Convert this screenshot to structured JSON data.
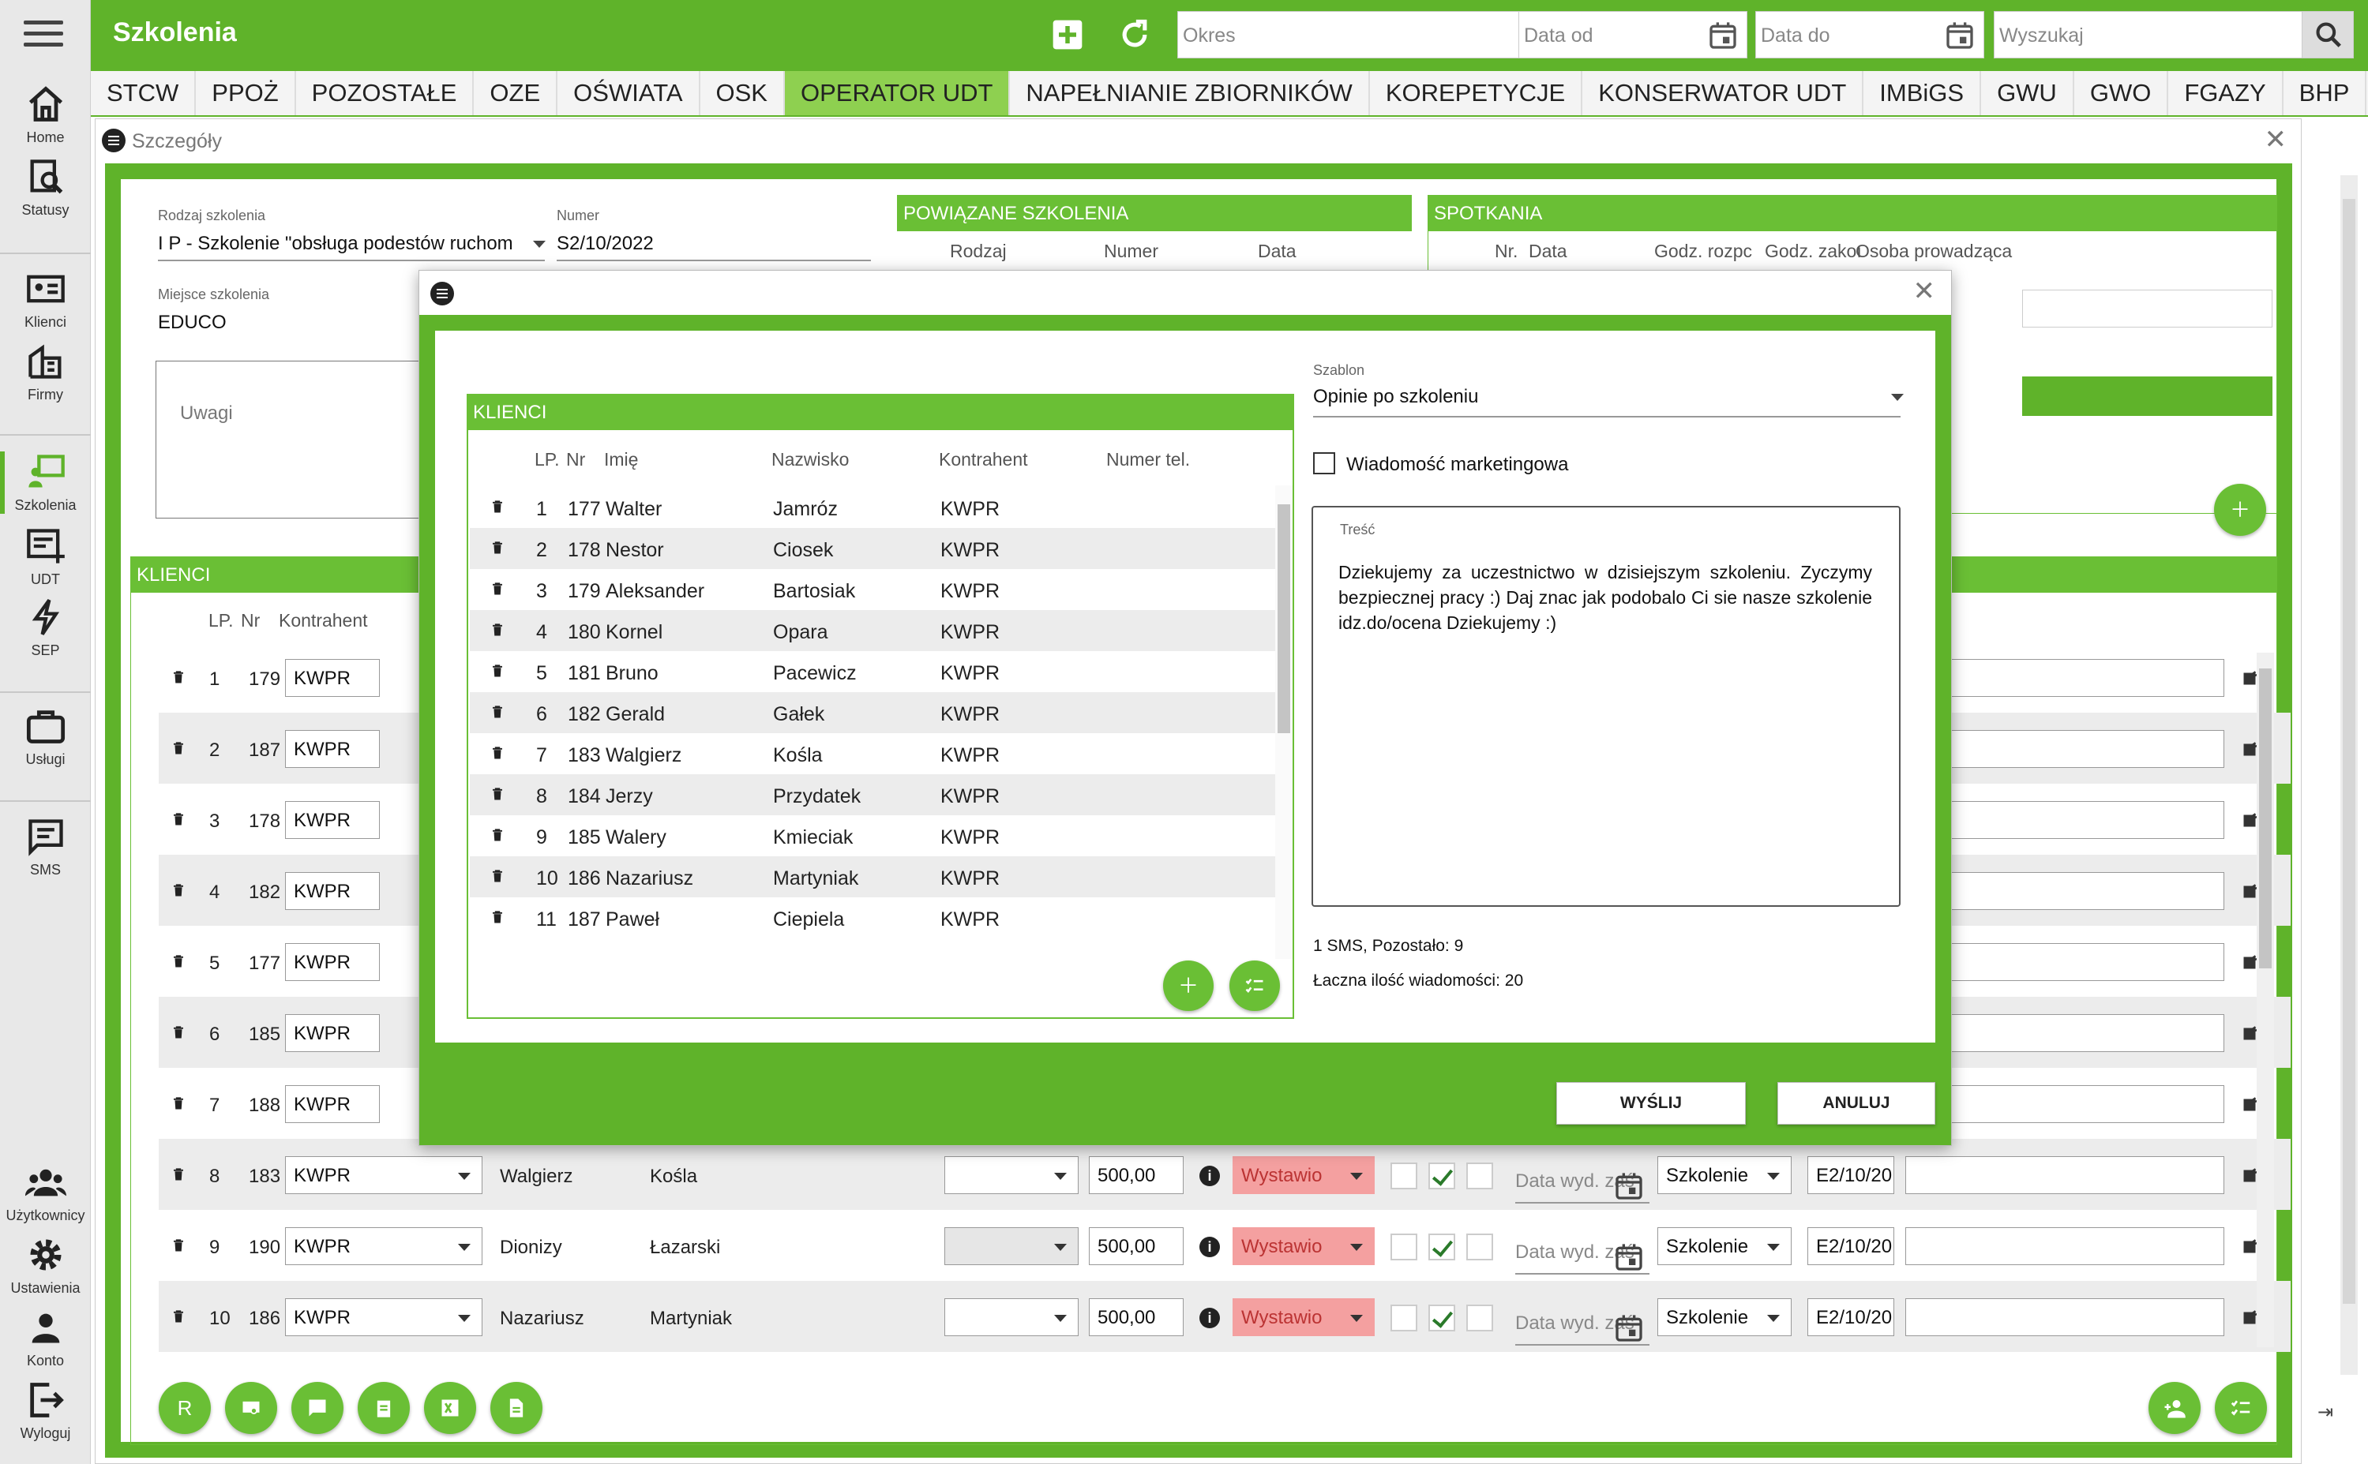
{
  "app": {
    "title": "Szkolenia"
  },
  "sidebar": {
    "items": [
      {
        "label": "Home",
        "icon": "home-icon"
      },
      {
        "label": "Statusy",
        "icon": "status-icon"
      },
      {
        "label": "Klienci",
        "icon": "clients-icon"
      },
      {
        "label": "Firmy",
        "icon": "companies-icon"
      },
      {
        "label": "Szkolenia",
        "icon": "training-icon"
      },
      {
        "label": "UDT",
        "icon": "udt-icon"
      },
      {
        "label": "SEP",
        "icon": "bolt-icon"
      },
      {
        "label": "Usługi",
        "icon": "briefcase-icon"
      },
      {
        "label": "SMS",
        "icon": "message-icon"
      },
      {
        "label": "Użytkownicy",
        "icon": "users-icon"
      },
      {
        "label": "Ustawienia",
        "icon": "gear-icon"
      },
      {
        "label": "Konto",
        "icon": "person-icon"
      },
      {
        "label": "Wyloguj",
        "icon": "logout-icon"
      }
    ]
  },
  "topbar": {
    "okres_placeholder": "Okres",
    "date_from_placeholder": "Data od",
    "date_to_placeholder": "Data do",
    "search_placeholder": "Wyszukaj"
  },
  "tabs": [
    "STCW",
    "PPOŻ",
    "POZOSTAŁE",
    "OZE",
    "OŚWIATA",
    "OSK",
    "OPERATOR UDT",
    "NAPEŁNIANIE ZBIORNIKÓW",
    "KOREPETYCJE",
    "KONSERWATOR UDT",
    "IMBiGS",
    "GWU",
    "GWO",
    "FGAZY",
    "BHP"
  ],
  "details": {
    "title": "Szczegóły",
    "rodzaj_label": "Rodzaj szkolenia",
    "rodzaj_value": "I P - Szkolenie \"obsługa podestów ruchom",
    "numer_label": "Numer",
    "numer_value": "S2/10/2022",
    "miejsce_label": "Miejsce szkolenia",
    "miejsce_value": "EDUCO",
    "uwagi_label": "Uwagi",
    "related": {
      "title": "POWIĄZANE SZKOLENIA",
      "cols": [
        "Rodzaj",
        "Numer",
        "Data"
      ]
    },
    "meetings": {
      "title": "SPOTKANIA",
      "cols": [
        "Nr.",
        "Data",
        "Godz. rozpc",
        "Godz. zakoı",
        "Osoba prowadząca"
      ]
    },
    "clients_title": "KLIENCI",
    "clients_cols": [
      "LP.",
      "Nr",
      "Kontrahent"
    ],
    "rows": [
      {
        "lp": "1",
        "nr": "179",
        "kontrahent": "KWPR"
      },
      {
        "lp": "2",
        "nr": "187",
        "kontrahent": "KWPR"
      },
      {
        "lp": "3",
        "nr": "178",
        "kontrahent": "KWPR"
      },
      {
        "lp": "4",
        "nr": "182",
        "kontrahent": "KWPR"
      },
      {
        "lp": "5",
        "nr": "177",
        "kontrahent": "KWPR"
      },
      {
        "lp": "6",
        "nr": "185",
        "kontrahent": "KWPR"
      },
      {
        "lp": "7",
        "nr": "188",
        "kontrahent": "KWPR"
      },
      {
        "lp": "8",
        "nr": "183",
        "kontrahent": "KWPR",
        "imie": "Walgierz",
        "nazwisko": "Kośla",
        "kwota": "500,00",
        "status": "Wystawio",
        "data_placeholder": "Data wyd. zaś",
        "typ": "Szkolenie",
        "kod": "E2/10/20"
      },
      {
        "lp": "9",
        "nr": "190",
        "kontrahent": "KWPR",
        "imie": "Dionizy",
        "nazwisko": "Łazarski",
        "kwota": "500,00",
        "status": "Wystawio",
        "data_placeholder": "Data wyd. zaś",
        "typ": "Szkolenie",
        "kod": "E2/10/20"
      },
      {
        "lp": "10",
        "nr": "186",
        "kontrahent": "KWPR",
        "imie": "Nazariusz",
        "nazwisko": "Martyniak",
        "kwota": "500,00",
        "status": "Wystawio",
        "data_placeholder": "Data wyd. zaś",
        "typ": "Szkolenie",
        "kod": "E2/10/20"
      }
    ],
    "bottom_r_label": "R"
  },
  "modal": {
    "clients_title": "KLIENCI",
    "cols": [
      "LP.",
      "Nr",
      "Imię",
      "Nazwisko",
      "Kontrahent",
      "Numer tel."
    ],
    "rows": [
      {
        "lp": "1",
        "nr": "177",
        "imie": "Walter",
        "nazwisko": "Jamróz",
        "kontrahent": "KWPR"
      },
      {
        "lp": "2",
        "nr": "178",
        "imie": "Nestor",
        "nazwisko": "Ciosek",
        "kontrahent": "KWPR"
      },
      {
        "lp": "3",
        "nr": "179",
        "imie": "Aleksander",
        "nazwisko": "Bartosiak",
        "kontrahent": "KWPR"
      },
      {
        "lp": "4",
        "nr": "180",
        "imie": "Kornel",
        "nazwisko": "Opara",
        "kontrahent": "KWPR"
      },
      {
        "lp": "5",
        "nr": "181",
        "imie": "Bruno",
        "nazwisko": "Pacewicz",
        "kontrahent": "KWPR"
      },
      {
        "lp": "6",
        "nr": "182",
        "imie": "Gerald",
        "nazwisko": "Gałek",
        "kontrahent": "KWPR"
      },
      {
        "lp": "7",
        "nr": "183",
        "imie": "Walgierz",
        "nazwisko": "Kośla",
        "kontrahent": "KWPR"
      },
      {
        "lp": "8",
        "nr": "184",
        "imie": "Jerzy",
        "nazwisko": "Przydatek",
        "kontrahent": "KWPR"
      },
      {
        "lp": "9",
        "nr": "185",
        "imie": "Walery",
        "nazwisko": "Kmieciak",
        "kontrahent": "KWPR"
      },
      {
        "lp": "10",
        "nr": "186",
        "imie": "Nazariusz",
        "nazwisko": "Martyniak",
        "kontrahent": "KWPR"
      },
      {
        "lp": "11",
        "nr": "187",
        "imie": "Paweł",
        "nazwisko": "Ciepiela",
        "kontrahent": "KWPR"
      }
    ],
    "szablon_label": "Szablon",
    "szablon_value": "Opinie po szkoleniu",
    "marketing_label": "Wiadomość marketingowa",
    "tresc_label": "Treść",
    "tresc_value": "Dziekujemy za uczestnictwo w dzisiejszym szkoleniu. Zyczymy bezpiecznej pracy :) Daj znac jak podobalo Ci sie nasze szkolenie idz.do/ocena Dziekujemy :)",
    "sms_info": "1 SMS, Pozostało: 9",
    "total_info": "Łaczna ilość wiadomości: 20",
    "send_label": "WYŚLIJ",
    "cancel_label": "ANULUJ"
  },
  "colors": {
    "accent": "#5fb32a",
    "status_red": "#f4a0a0"
  }
}
